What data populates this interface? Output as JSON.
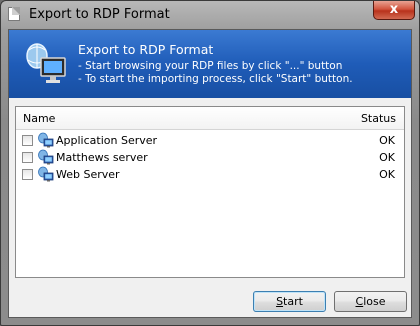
{
  "window": {
    "title": "Export to RDP Format",
    "close_glyph": "x"
  },
  "banner": {
    "icon": "rdp-remote-desktop-icon",
    "title": "Export to RDP Format",
    "line1": "- Start browsing your RDP files by click \"...\" button",
    "line2": "- To start the importing process, click \"Start\" button."
  },
  "list": {
    "headers": {
      "name": "Name",
      "status": "Status"
    },
    "rows": [
      {
        "name": "Application Server",
        "status": "OK",
        "checked": false
      },
      {
        "name": "Matthews server",
        "status": "OK",
        "checked": false
      },
      {
        "name": "Web Server",
        "status": "OK",
        "checked": false
      }
    ]
  },
  "buttons": {
    "start": {
      "label": "Start",
      "mnemonic": "S",
      "rest": "tart"
    },
    "close": {
      "label": "Close",
      "mnemonic": "C",
      "rest": "lose"
    }
  },
  "colors": {
    "banner_blue": "#1f5cb8",
    "close_red": "#c7432b"
  }
}
